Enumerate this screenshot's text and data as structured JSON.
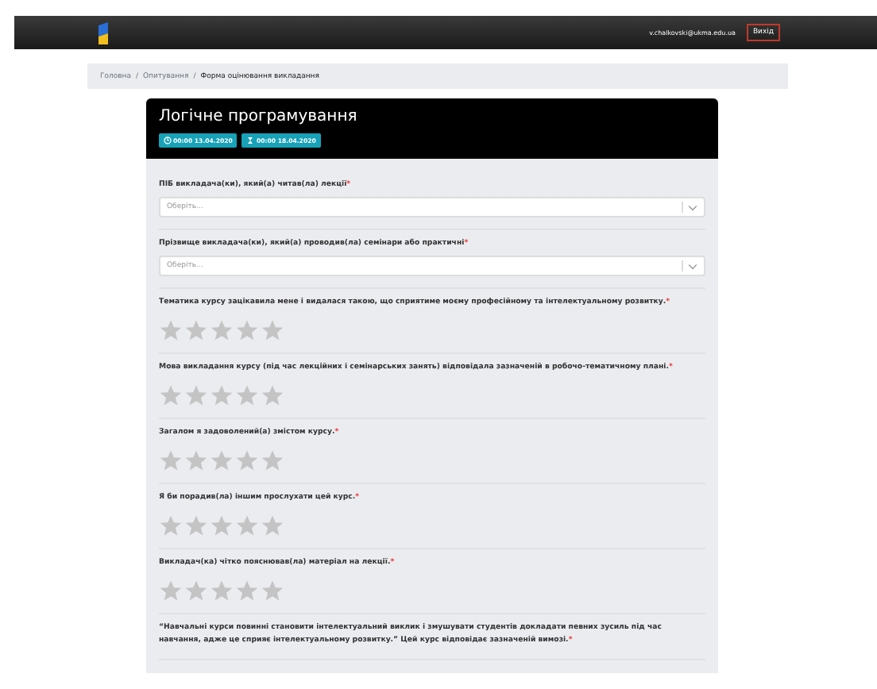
{
  "navbar": {
    "user_email": "v.chalkovski@ukma.edu.ua",
    "logout": "Вихід"
  },
  "breadcrumb": [
    {
      "label": "Головна",
      "current": false
    },
    {
      "separator": "/",
      "label": "Опитування",
      "current": false
    },
    {
      "separator": "/",
      "label": "Форма оцінювання викладання",
      "current": true
    }
  ],
  "survey": {
    "title": "Логічне програмування",
    "badges": [
      {
        "kind": "start",
        "text": "00:00 13.04.2020"
      },
      {
        "kind": "end",
        "text": "00:00 18.04.2020"
      }
    ],
    "questions": [
      {
        "kind": "select",
        "label": "ПІБ викладача(ки), який(а) читав(ла) лекції",
        "mark": "*",
        "placeholder": "Оберіть..."
      },
      {
        "kind": "select",
        "label": "Прізвище викладача(ки), який(а) проводив(ла) семінари або практичні",
        "mark": "*",
        "placeholder": "Оберіть..."
      },
      {
        "kind": "stars",
        "label": "Тематика курсу зацікавила мене і видалася такою, що сприятиме моєму професійному та інтелектуальному розвитку.",
        "mark": "*",
        "stars": 0
      },
      {
        "kind": "stars",
        "label": "Мова викладання курсу (під час лекційних і семінарських занять) відповідала зазначеній в робочо-тематичному плані.",
        "mark": "*",
        "stars": 0
      },
      {
        "kind": "stars",
        "label": "Загалом я задоволений(а) змістом курсу.",
        "mark": "*",
        "stars": 0
      },
      {
        "kind": "stars",
        "label": "Я би порадив(ла) іншим прослухати цей курс.",
        "mark": "*",
        "stars": 0
      },
      {
        "kind": "stars",
        "label": "Викладач(ка) чітко пояснював(ла) матеріал на лекції.",
        "mark": "*",
        "stars": 0
      },
      {
        "kind": "text",
        "label": "“Навчальні курси повинні становити інтелектуальний виклик і змушувати студентів докладати певних зусиль під час навчання, адже це сприяє інтелектуальному розвитку.” Цей курс відповідає зазначеній вимозі.",
        "mark": "*"
      }
    ]
  }
}
